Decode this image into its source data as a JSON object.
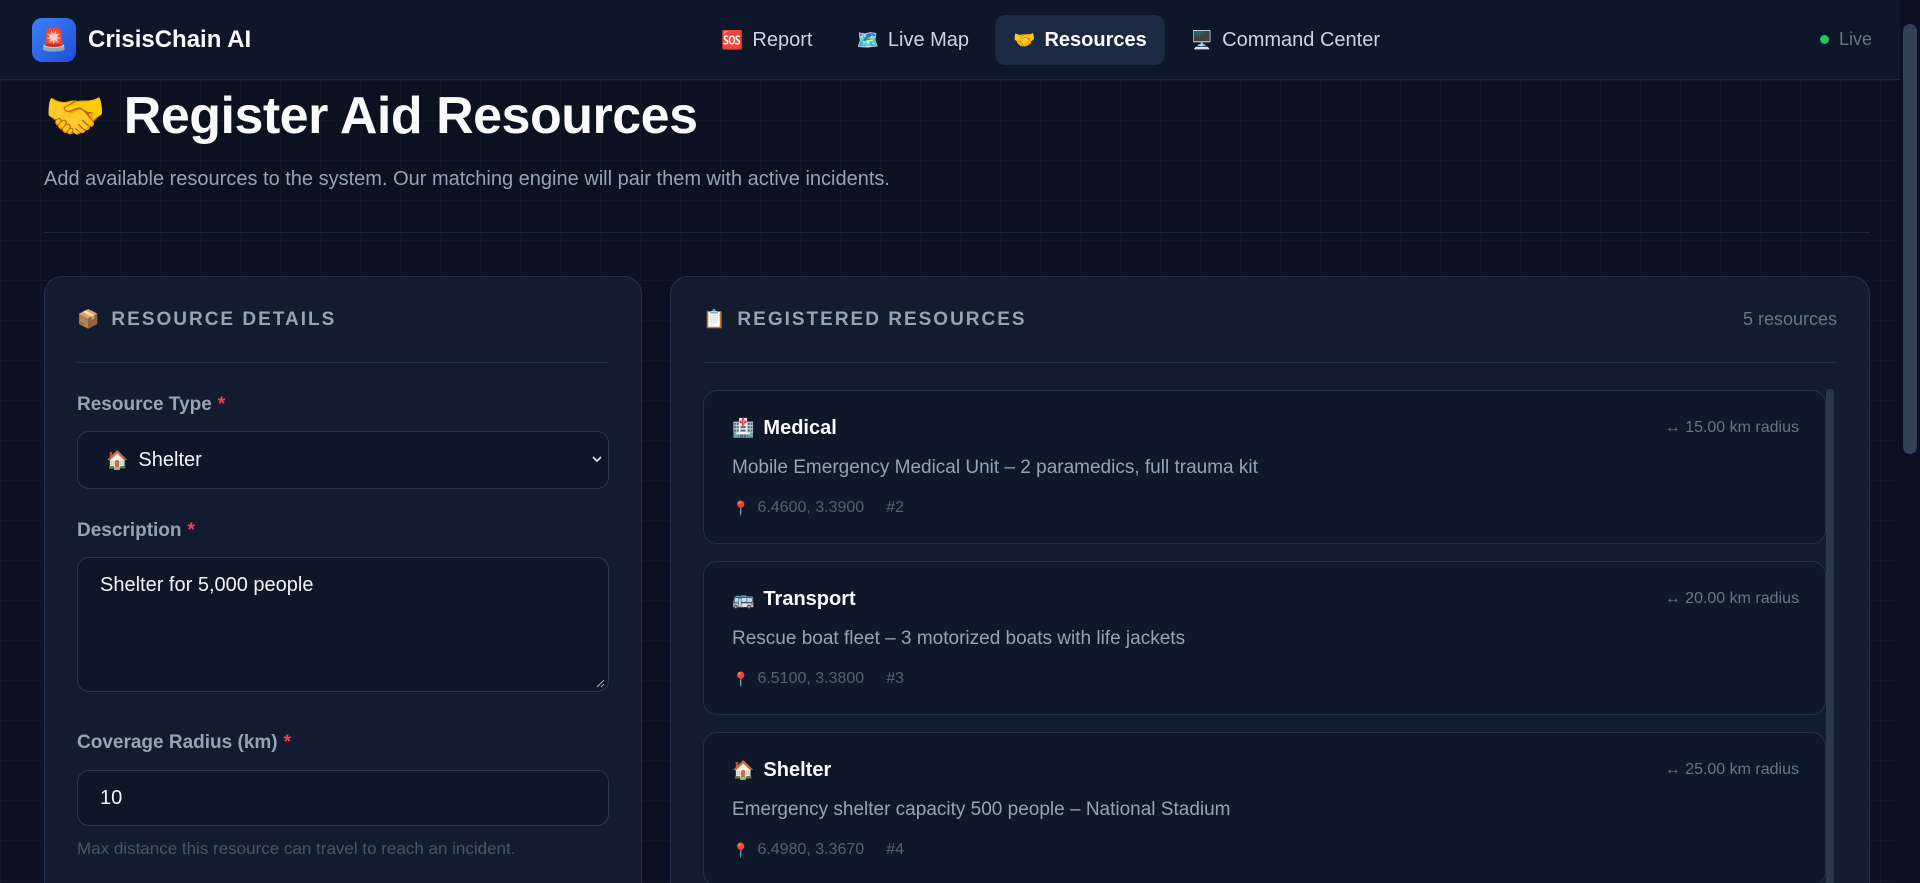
{
  "app": {
    "name": "CrisisChain AI",
    "logo_icon": "🚨"
  },
  "nav": {
    "items": [
      {
        "icon": "🆘",
        "label": "Report"
      },
      {
        "icon": "🗺️",
        "label": "Live Map"
      },
      {
        "icon": "🤝",
        "label": "Resources",
        "active": true
      },
      {
        "icon": "🖥️",
        "label": "Command Center"
      }
    ],
    "status": "Live"
  },
  "page": {
    "icon": "🤝",
    "title": "Register Aid Resources",
    "subtitle": "Add available resources to the system. Our matching engine will pair them with active incidents."
  },
  "form": {
    "icon": "📦",
    "title": "RESOURCE DETAILS",
    "type_label": "Resource Type",
    "type_value_icon": "🏠",
    "type_value": "Shelter",
    "desc_label": "Description",
    "desc_value": "Shelter for 5,000 people",
    "radius_label": "Coverage Radius (km)",
    "radius_value": "10",
    "radius_hint": "Max distance this resource can travel to reach an incident.",
    "required_mark": "*"
  },
  "registered": {
    "icon": "📋",
    "title": "REGISTERED RESOURCES",
    "count": "5 resources",
    "items": [
      {
        "icon": "🏥",
        "type": "Medical",
        "radius": "↔ 15.00 km radius",
        "desc": "Mobile Emergency Medical Unit – 2 paramedics, full trauma kit",
        "coords": "6.4600, 3.3900",
        "id": "#2"
      },
      {
        "icon": "🚌",
        "type": "Transport",
        "radius": "↔ 20.00 km radius",
        "desc": "Rescue boat fleet – 3 motorized boats with life jackets",
        "coords": "6.5100, 3.3800",
        "id": "#3"
      },
      {
        "icon": "🏠",
        "type": "Shelter",
        "radius": "↔ 25.00 km radius",
        "desc": "Emergency shelter capacity 500 people – National Stadium",
        "coords": "6.4980, 3.3670",
        "id": "#4"
      }
    ],
    "pin_icon": "📍"
  },
  "colors": {
    "accent": "#3b82f6",
    "required": "#f43f5e",
    "live": "#22c55e",
    "background": "#0b1120"
  }
}
